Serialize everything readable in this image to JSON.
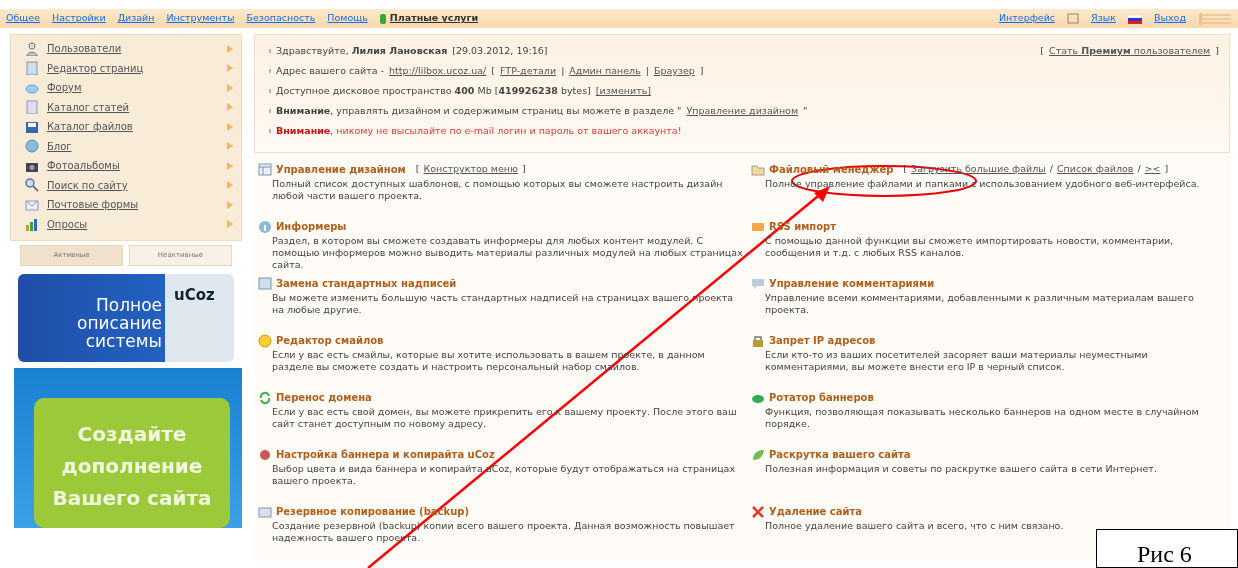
{
  "top_menu": {
    "items": [
      {
        "label": "Общее"
      },
      {
        "label": "Настройки"
      },
      {
        "label": "Дизайн"
      },
      {
        "label": "Инструменты"
      },
      {
        "label": "Безопасность"
      },
      {
        "label": "Помощь"
      },
      {
        "label": "Платные услуги",
        "highlight": true
      }
    ],
    "right": [
      {
        "label": "Интерфейс"
      },
      {
        "label": "Язык"
      },
      {
        "label": "Выход"
      }
    ]
  },
  "sidebar": {
    "items": [
      {
        "label": "Пользователи"
      },
      {
        "label": "Редактор страниц"
      },
      {
        "label": "Форум"
      },
      {
        "label": "Каталог статей"
      },
      {
        "label": "Каталог файлов"
      },
      {
        "label": "Блог"
      },
      {
        "label": "Фотоальбомы"
      },
      {
        "label": "Поиск по сайту"
      },
      {
        "label": "Почтовые формы"
      },
      {
        "label": "Опросы"
      }
    ],
    "tabs": [
      {
        "label": "Активные",
        "selected": true
      },
      {
        "label": "Неактивные",
        "selected": false
      }
    ],
    "banners": [
      {
        "lines": [
          "Полное",
          "описание",
          "системы"
        ],
        "badge": "uCoz"
      },
      {
        "lines": [
          "Создайте",
          "дополнение",
          "Вашего сайта"
        ]
      }
    ]
  },
  "info": {
    "lines": [
      {
        "warning": false,
        "parts": [
          {
            "kind": "text",
            "text": "Здравствуйте, **Лилия Лановская**"
          },
          {
            "kind": "text",
            "text": "[29.03.2012, 19:16]"
          }
        ]
      },
      {
        "warning": false,
        "parts": [
          {
            "kind": "text",
            "text": "Адрес вашего сайта -"
          },
          {
            "kind": "link",
            "text": "http://lilbox.ucoz.ua/"
          },
          {
            "kind": "text",
            "text": "["
          },
          {
            "kind": "link",
            "text": "FTP-детали"
          },
          {
            "kind": "text",
            "text": "|"
          },
          {
            "kind": "link",
            "text": "Админ панель"
          },
          {
            "kind": "text",
            "text": "|"
          },
          {
            "kind": "link",
            "text": "Браузер"
          },
          {
            "kind": "text",
            "text": "]"
          }
        ]
      },
      {
        "warning": false,
        "parts": [
          {
            "kind": "text",
            "text": "Доступное дисковое пространство **400** Mb [**419926238** bytes]"
          },
          {
            "kind": "link",
            "text": "[изменить]"
          }
        ]
      },
      {
        "warning": false,
        "parts": [
          {
            "kind": "text",
            "text": "**Внимание**, управлять дизайном и содержимым страниц вы можете в разделе \""
          },
          {
            "kind": "link",
            "text": "Управление дизайном"
          },
          {
            "kind": "text",
            "text": "\""
          }
        ]
      },
      {
        "warning": true,
        "parts": [
          {
            "kind": "text",
            "text": "**Внимание**, никому не высылайте по e-mail логин и пароль от вашего аккаунта!"
          }
        ]
      }
    ],
    "premium": [
      {
        "kind": "text",
        "text": "["
      },
      {
        "kind": "link",
        "text": "Стать **Премиум** пользователем"
      },
      {
        "kind": "text",
        "text": "]"
      }
    ]
  },
  "sections": [
    {
      "title": "Управление дизайном",
      "links": [
        {
          "kind": "text",
          "text": "["
        },
        {
          "kind": "link",
          "text": "Конструктор меню"
        },
        {
          "kind": "text",
          "text": "]"
        }
      ],
      "description": "Полный список доступных шаблонов, с помощью которых вы сможете настроить дизайн любой части вашего проекта."
    },
    {
      "title": "Файловый менеджер",
      "links": [
        {
          "kind": "text",
          "text": "["
        },
        {
          "kind": "link",
          "text": "Загрузить большие файлы"
        },
        {
          "kind": "text",
          "text": "/"
        },
        {
          "kind": "link",
          "text": "Список файлов"
        },
        {
          "kind": "text",
          "text": "/"
        },
        {
          "kind": "link",
          "text": "><"
        },
        {
          "kind": "text",
          "text": "]"
        }
      ],
      "description": "Полное управление файлами и папками с использованием удобного веб-интерфейса."
    },
    {
      "title": "Информеры",
      "description": "Раздел, в котором вы сможете создавать информеры для любых контент модулей. С помощью информеров можно выводить материалы различных модулей на любых страницах сайта."
    },
    {
      "title": "RSS импорт",
      "description": "С помощью данной функции вы сможете импортировать новости, комментарии, сообщения и т.д. с любых RSS каналов."
    },
    {
      "title": "Замена стандартных надписей",
      "description": "Вы можете изменить большую часть стандартных надписей на страницах вашего проекта на любые другие."
    },
    {
      "title": "Управление комментариями",
      "description": "Управление всеми комментариями, добавленными к различным материалам вашего проекта."
    },
    {
      "title": "Редактор смайлов",
      "description": "Если у вас есть смайлы, которые вы хотите использовать в вашем проекте, в данном разделе вы сможете создать и настроить персональный набор смайлов."
    },
    {
      "title": "Запрет IP адресов",
      "description": "Если кто-то из ваших посетителей засоряет ваши материалы неуместными комментариями, вы можете внести его IP в черный список."
    },
    {
      "title": "Перенос домена",
      "description": "Если у вас есть свой домен, вы можете прикрепить его к вашему проекту. После этого ваш сайт станет доступным по новому адресу."
    },
    {
      "title": "Ротатор баннеров",
      "description": "Функция, позволяющая показывать несколько баннеров на одном месте в случайном порядке."
    },
    {
      "title": "Настройка баннера и копирайта uCoz",
      "description": "Выбор цвета и вида баннера и копирайта uCoz, которые будут отображаться на страницах вашего проекта."
    },
    {
      "title": "Раскрутка вашего сайта",
      "description": "Полезная информация и советы по раскрутке вашего сайта в сети Интернет."
    },
    {
      "title": "Резервное копирование (backup)",
      "description": "Создание резервной (backup) копии всего вашего проекта. Данная возможность повышает надежность вашего проекта."
    },
    {
      "title": "Удаление сайта",
      "description": "Полное удаление вашего сайта и всего, что с ним связано."
    }
  ],
  "figure_label": "Рис 6"
}
